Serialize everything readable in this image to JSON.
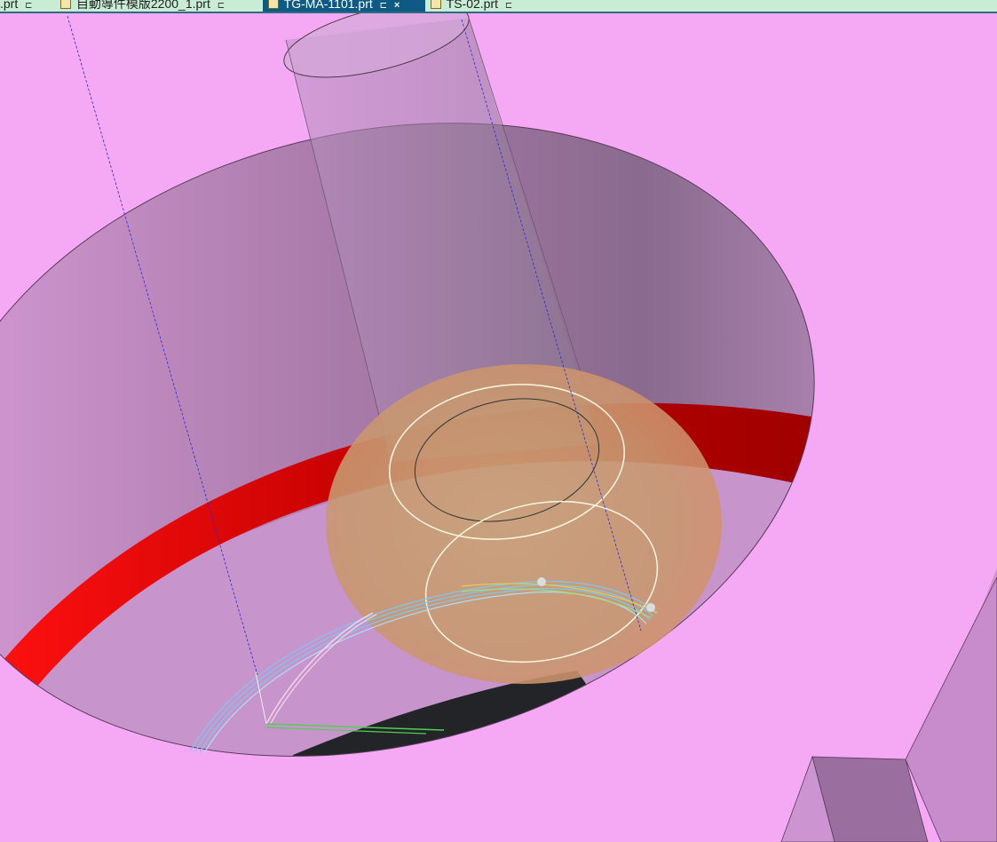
{
  "tabs": [
    {
      "label": ".prt",
      "active": false
    },
    {
      "label": "自動導件模版2200_1.prt",
      "active": false
    },
    {
      "label": "TG-MA-1101.prt",
      "active": true
    },
    {
      "label": "TS-02.prt",
      "active": false
    }
  ],
  "viewport": {
    "background_color": "#f5a9f5",
    "part_color": "#f5a9f5",
    "ring_color": "#ff0000",
    "sphere_color": "#c8a070",
    "toolpath_colors": [
      "#7ec8f0",
      "#f0c8e0",
      "#50d050",
      "#e0d050"
    ]
  }
}
